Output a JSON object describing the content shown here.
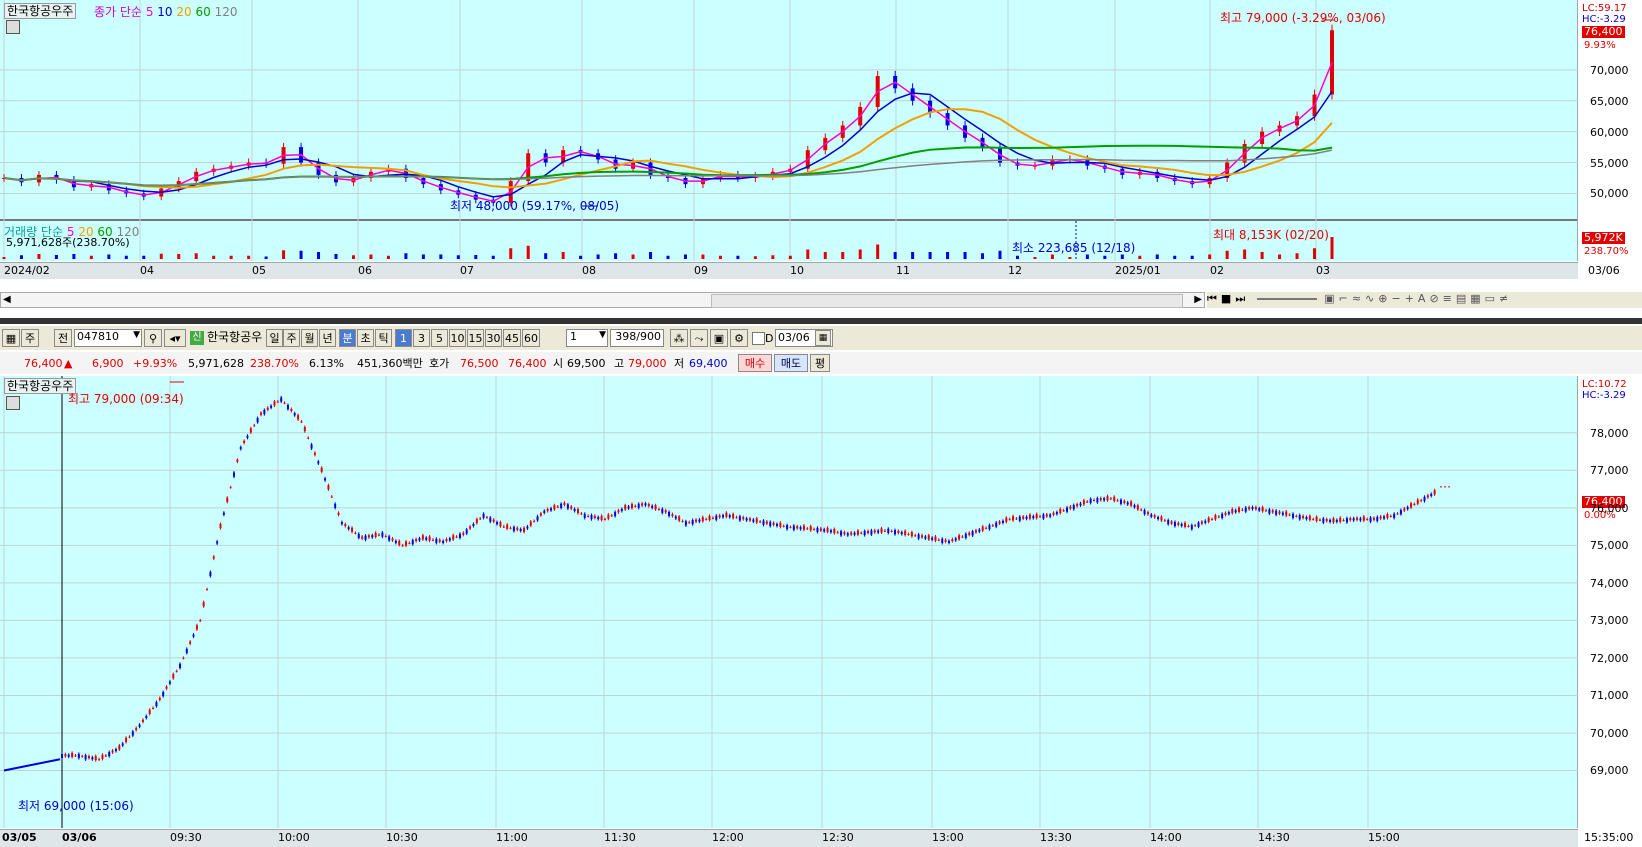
{
  "top_chart": {
    "stock_name": "한국항공우주",
    "legend_title": "종가 단순",
    "ma_periods": [
      "5",
      "10",
      "20",
      "60",
      "120"
    ],
    "lc_label": "LC:59.17",
    "hc_label": "HC:-3.29",
    "price_tag": "76,400",
    "change_tag": "9.93%",
    "high_annotation": "최고 79,000 (-3.29%, 03/06)",
    "low_annotation": "최저 48,000 (59.17%, 08/05)",
    "y_ticks": [
      "70,000",
      "65,000",
      "60,000",
      "55,000",
      "50,000"
    ],
    "volume_legend_title": "거래량 단순",
    "volume_ma_periods": [
      "5",
      "20",
      "60",
      "120"
    ],
    "volume_value": "5,971,628주(238.70%)",
    "volume_max_annotation": "최대 8,153K (02/20)",
    "volume_min_annotation": "최소 223,685 (12/18)",
    "volume_tag": "5,972K",
    "volume_pct_tag": "238.70%",
    "x_labels": [
      "2024/02",
      "04",
      "05",
      "06",
      "07",
      "08",
      "09",
      "10",
      "11",
      "12",
      "2025/01",
      "02",
      "03"
    ],
    "x_right_label": "03/06",
    "colors": {
      "ma5": "#ff00cc",
      "ma10": "#0000cc",
      "ma20": "#f0a000",
      "ma60": "#00a000",
      "ma120": "#808080",
      "up": "#e00000",
      "down": "#0000e0"
    }
  },
  "toolbar": {
    "period": "주",
    "prev": "전",
    "code": "047810",
    "name_badge": "신",
    "stock_name": "한국항공우",
    "timeframes": [
      "일",
      "주",
      "월",
      "년",
      "분",
      "초",
      "틱"
    ],
    "minutes": [
      "1",
      "3",
      "5",
      "10",
      "15",
      "30",
      "45",
      "60"
    ],
    "count_value": "1",
    "count_display": "398/900",
    "date_marker": "D",
    "date_value": "03/06"
  },
  "quote_bar": {
    "price": "76,400",
    "arrow": "▲",
    "change": "6,900",
    "change_pct": "+9.93%",
    "volume": "5,971,628",
    "volume_pct": "238.70%",
    "turnover": "6.13%",
    "amount": "451,360백만",
    "hoga_label": "호가",
    "ask": "76,500",
    "bid": "76,400",
    "open_label": "시",
    "open": "69,500",
    "high_label": "고",
    "high": "79,000",
    "low_label": "저",
    "low": "69,400",
    "buy_button": "매수",
    "sell_button": "매도",
    "eval_button": "평"
  },
  "bottom_chart": {
    "stock_name": "한국항공우주",
    "lc_label": "LC:10.72",
    "hc_label": "HC:-3.29",
    "price_tag": "76,400",
    "change_tag": "0.00%",
    "high_annotation": "최고 79,000 (09:34)",
    "low_annotation": "최저 69,000 (15:06)",
    "y_ticks": [
      "78,000",
      "77,000",
      "76,000",
      "75,000",
      "74,000",
      "73,000",
      "72,000",
      "71,000",
      "70,000",
      "69,000"
    ],
    "x_labels": [
      "03/05",
      "03/06",
      "09:30",
      "10:00",
      "10:30",
      "11:00",
      "11:30",
      "12:00",
      "12:30",
      "13:00",
      "13:30",
      "14:00",
      "14:30",
      "15:00"
    ],
    "x_right_label": "15:35:00"
  },
  "chart_data": [
    {
      "type": "candlestick",
      "title": "한국항공우주",
      "x_range": [
        "2024/02",
        "2025/03/06"
      ],
      "ylim": [
        47000,
        80000
      ],
      "closes": [
        52500,
        51800,
        53000,
        52200,
        51000,
        51500,
        50500,
        50000,
        49500,
        50800,
        52000,
        53500,
        54000,
        54500,
        55000,
        54800,
        57500,
        55000,
        53000,
        51800,
        52500,
        53500,
        54000,
        52500,
        51500,
        50500,
        49800,
        49000,
        48500,
        52000,
        56500,
        55000,
        57000,
        56500,
        55500,
        54000,
        55000,
        53000,
        52500,
        51500,
        52500,
        53000,
        52500,
        52800,
        53500,
        54000,
        57000,
        59000,
        61000,
        64000,
        69000,
        67000,
        65000,
        63000,
        61000,
        59000,
        57500,
        55000,
        54500,
        54500,
        55500,
        55500,
        54500,
        54000,
        53000,
        53500,
        52500,
        52000,
        51500,
        52500,
        55000,
        58000,
        60000,
        61000,
        62500,
        66000,
        76400
      ],
      "high": 79000,
      "low": 48000
    },
    {
      "type": "candlestick",
      "title": "한국항공우주 1분",
      "date": "03/06",
      "ylim": [
        68800,
        79300
      ],
      "closes": [
        69400,
        69300,
        69600,
        70200,
        70900,
        71800,
        73000,
        75500,
        77600,
        78500,
        78900,
        78300,
        77000,
        75600,
        75200,
        75300,
        75000,
        75200,
        75100,
        75300,
        75800,
        75500,
        75400,
        75900,
        76100,
        75800,
        75700,
        76000,
        76100,
        75900,
        75600,
        75700,
        75800,
        75700,
        75600,
        75500,
        75450,
        75400,
        75300,
        75350,
        75400,
        75300,
        75200,
        75100,
        75300,
        75500,
        75700,
        75750,
        75800,
        76000,
        76200,
        76250,
        76100,
        75800,
        75600,
        75500,
        75700,
        75900,
        76000,
        75900,
        75800,
        75700,
        75650,
        75700,
        75700,
        75800,
        76100,
        76400
      ],
      "high": 79000,
      "low": 69000
    }
  ]
}
